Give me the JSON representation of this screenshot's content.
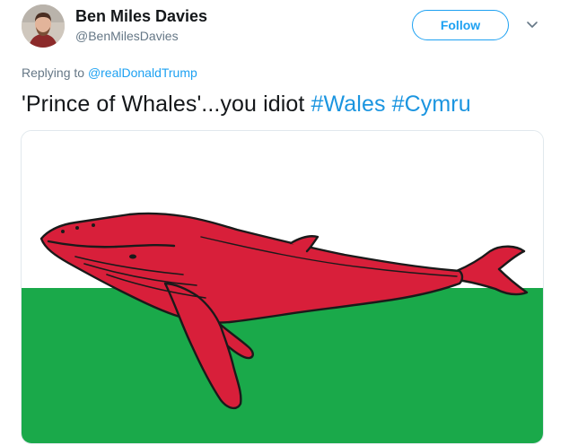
{
  "author": {
    "display_name": "Ben Miles Davies",
    "handle": "@BenMilesDavies",
    "avatar_icon": "user-avatar-photo"
  },
  "actions": {
    "follow_label": "Follow",
    "menu_icon": "chevron-down-icon"
  },
  "reply": {
    "prefix": "Replying to ",
    "mention": "@realDonaldTrump"
  },
  "tweet": {
    "text": "'Prince of Whales'...you idiot ",
    "hashtags": [
      "#Wales",
      "#Cymru"
    ]
  },
  "colors": {
    "accent": "#1da1f2",
    "flag_white": "#ffffff",
    "flag_green": "#1aa94a",
    "whale_red": "#d81f3a",
    "text_primary": "#14171a",
    "text_secondary": "#657786"
  }
}
